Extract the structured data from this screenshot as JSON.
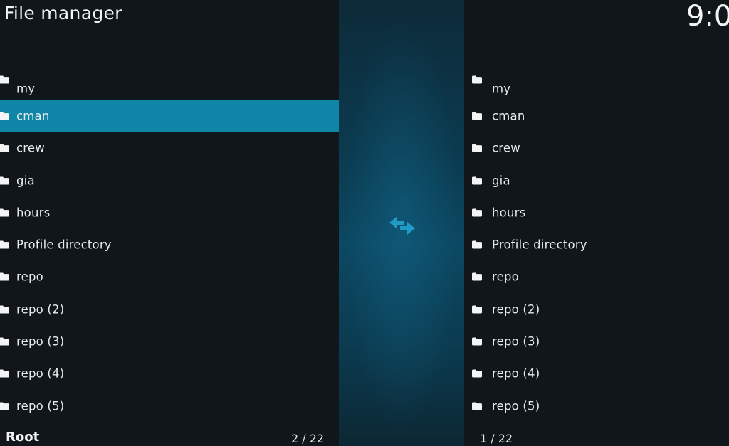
{
  "window": {
    "title": "File manager",
    "clock": "9:0"
  },
  "left_pane": {
    "items": [
      {
        "label": "my",
        "icon": "folder-icon"
      },
      {
        "label": "cman",
        "icon": "folder-icon",
        "selected": true
      },
      {
        "label": "crew",
        "icon": "folder-icon"
      },
      {
        "label": "gia",
        "icon": "folder-icon"
      },
      {
        "label": "hours",
        "icon": "folder-icon"
      },
      {
        "label": "Profile directory",
        "icon": "folder-icon"
      },
      {
        "label": "repo",
        "icon": "folder-icon"
      },
      {
        "label": "repo (2)",
        "icon": "folder-icon"
      },
      {
        "label": "repo (3)",
        "icon": "folder-icon"
      },
      {
        "label": "repo (4)",
        "icon": "folder-icon"
      },
      {
        "label": "repo (5)",
        "icon": "folder-icon"
      }
    ],
    "footer_label": "Root",
    "count": "2 / 22"
  },
  "right_pane": {
    "items": [
      {
        "label": "my",
        "icon": "folder-icon"
      },
      {
        "label": "cman",
        "icon": "folder-icon"
      },
      {
        "label": "crew",
        "icon": "folder-icon"
      },
      {
        "label": "gia",
        "icon": "folder-icon"
      },
      {
        "label": "hours",
        "icon": "folder-icon"
      },
      {
        "label": "Profile directory",
        "icon": "folder-icon"
      },
      {
        "label": "repo",
        "icon": "folder-icon"
      },
      {
        "label": "repo (2)",
        "icon": "folder-icon"
      },
      {
        "label": "repo (3)",
        "icon": "folder-icon"
      },
      {
        "label": "repo (4)",
        "icon": "folder-icon"
      },
      {
        "label": "repo (5)",
        "icon": "folder-icon"
      }
    ],
    "count": "1 / 22"
  },
  "divider": {
    "icon": "swap-arrows-icon"
  },
  "colors": {
    "background": "#101619",
    "selection": "#0f86a8",
    "accent": "#1f9bc6",
    "text": "#e8eaeb"
  }
}
